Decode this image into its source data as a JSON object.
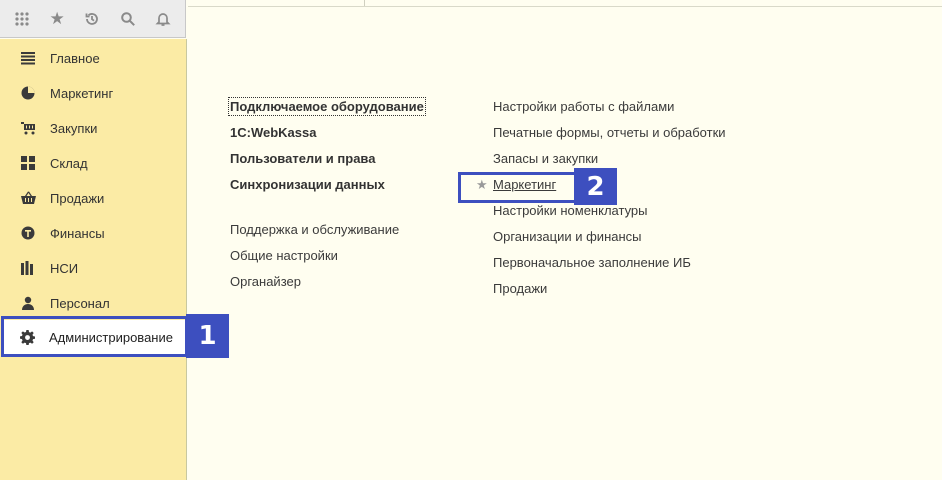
{
  "toolbar": {
    "icons": [
      "apps-grid-icon",
      "star-icon",
      "history-icon",
      "search-icon",
      "bell-icon"
    ]
  },
  "sidebar": {
    "items": [
      {
        "label": "Главное",
        "icon": "menu-lines-icon"
      },
      {
        "label": "Маркетинг",
        "icon": "pie-chart-icon"
      },
      {
        "label": "Закупки",
        "icon": "cart-icon"
      },
      {
        "label": "Склад",
        "icon": "warehouse-grid-icon"
      },
      {
        "label": "Продажи",
        "icon": "basket-icon"
      },
      {
        "label": "Финансы",
        "icon": "coin-icon"
      },
      {
        "label": "НСИ",
        "icon": "books-icon"
      },
      {
        "label": "Персонал",
        "icon": "person-icon"
      },
      {
        "label": "Администрирование",
        "icon": "gear-icon"
      }
    ],
    "active_index": 8
  },
  "left_column": {
    "bold_links": [
      "Подключаемое оборудование",
      "1С:WebKassa",
      "Пользователи и права",
      "Синхронизации данных"
    ],
    "links": [
      "Поддержка и обслуживание",
      "Общие настройки",
      "Органайзер"
    ]
  },
  "right_column": {
    "links": [
      "Настройки работы с файлами",
      "Печатные формы, отчеты и обработки",
      "Запасы и закупки",
      "Маркетинг",
      "Настройки номенклатуры",
      "Организации и финансы",
      "Первоначальное заполнение ИБ",
      "Продажи"
    ]
  },
  "annotations": {
    "badge1": "1",
    "badge2": "2",
    "color": "#3d4fbf"
  },
  "colors": {
    "sidebar_bg": "#fbeba5",
    "content_bg": "#fffef0",
    "toolbar_bg": "#ececec"
  }
}
